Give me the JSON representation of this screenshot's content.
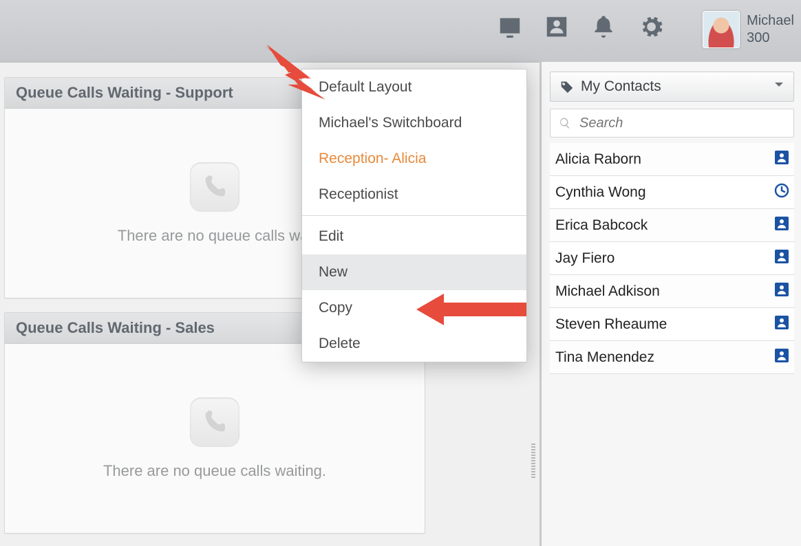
{
  "toolbar": {
    "user_name": "Michael",
    "user_ext": "300"
  },
  "queues": [
    {
      "title": "Queue Calls Waiting - Support",
      "empty_text": "There are no queue calls wai"
    },
    {
      "title": "Queue Calls Waiting - Sales",
      "empty_text": "There are no queue calls waiting."
    }
  ],
  "context_menu": {
    "layouts": [
      {
        "label": "Default Layout",
        "active": false
      },
      {
        "label": "Michael's Switchboard",
        "active": false
      },
      {
        "label": "Reception- Alicia",
        "active": true
      },
      {
        "label": "Receptionist",
        "active": false
      }
    ],
    "actions": [
      {
        "label": "Edit",
        "hover": false
      },
      {
        "label": "New",
        "hover": true
      },
      {
        "label": "Copy",
        "hover": false
      },
      {
        "label": "Delete",
        "hover": false
      }
    ]
  },
  "sidebar": {
    "dropdown_label": "My Contacts",
    "search_placeholder": "Search",
    "contacts": [
      {
        "name": "Alicia Raborn",
        "status": "presence"
      },
      {
        "name": "Cynthia Wong",
        "status": "clock"
      },
      {
        "name": "Erica Babcock",
        "status": "presence"
      },
      {
        "name": "Jay Fiero",
        "status": "presence"
      },
      {
        "name": "Michael Adkison",
        "status": "presence"
      },
      {
        "name": "Steven Rheaume",
        "status": "presence"
      },
      {
        "name": "Tina Menendez",
        "status": "presence"
      }
    ]
  }
}
